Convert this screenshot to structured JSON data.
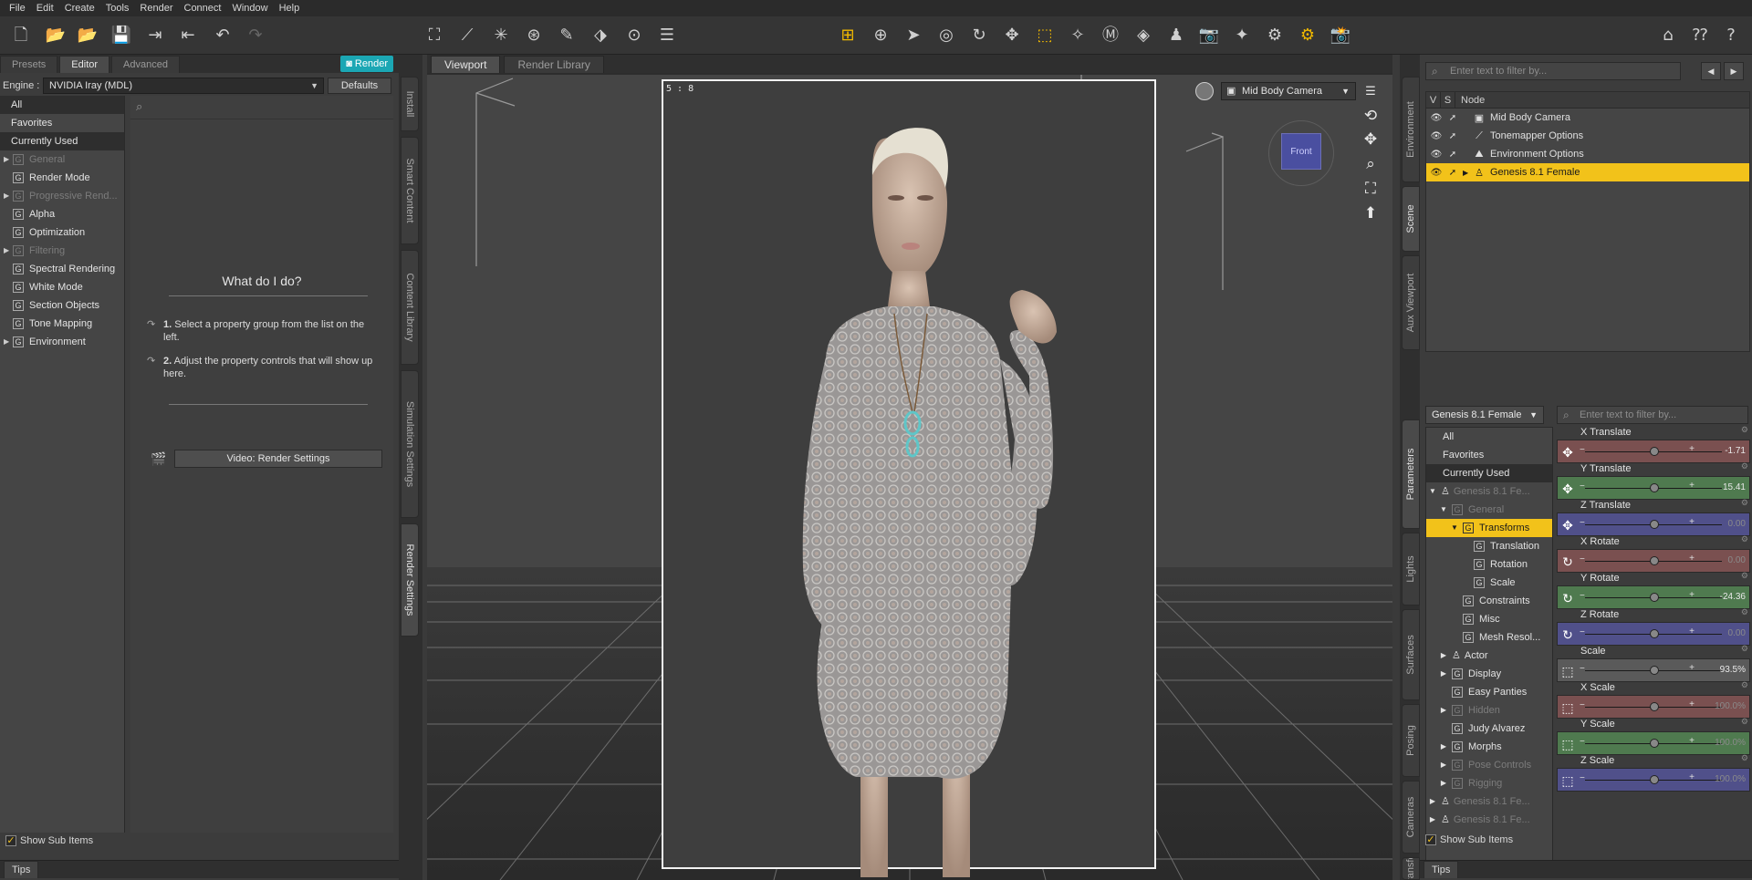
{
  "menu": [
    "File",
    "Edit",
    "Create",
    "Tools",
    "Render",
    "Connect",
    "Window",
    "Help"
  ],
  "left_panel": {
    "tabs": [
      "Presets",
      "Editor",
      "Advanced"
    ],
    "render_button": "Render",
    "engine_label": "Engine :",
    "engine_value": "NVIDIA Iray (MDL)",
    "defaults_button": "Defaults",
    "groups": [
      {
        "label": "All",
        "kind": "plain",
        "selected": true
      },
      {
        "label": "Favorites",
        "kind": "plain"
      },
      {
        "label": "Currently Used",
        "kind": "plain",
        "selected": true
      },
      {
        "label": "General",
        "kind": "group",
        "expandable": true,
        "dim": true
      },
      {
        "label": "Render Mode",
        "kind": "group"
      },
      {
        "label": "Progressive Rend...",
        "kind": "group",
        "expandable": true,
        "dim": true
      },
      {
        "label": "Alpha",
        "kind": "group"
      },
      {
        "label": "Optimization",
        "kind": "group"
      },
      {
        "label": "Filtering",
        "kind": "group",
        "expandable": true,
        "dim": true
      },
      {
        "label": "Spectral Rendering",
        "kind": "group"
      },
      {
        "label": "White Mode",
        "kind": "group"
      },
      {
        "label": "Section Objects",
        "kind": "group"
      },
      {
        "label": "Tone Mapping",
        "kind": "group"
      },
      {
        "label": "Environment",
        "kind": "group",
        "expandable": true
      }
    ],
    "help_title": "What do I do?",
    "step1_num": "1.",
    "step1_text": "Select a property group from the list on the left.",
    "step2_num": "2.",
    "step2_text": "Adjust the property controls that will show up here.",
    "video_button": "Video: Render Settings",
    "show_sub_items": "Show Sub Items",
    "tips_tab": "Tips",
    "side_tabs": [
      "Install",
      "Smart Content",
      "Content Library",
      "Simulation Settings",
      "Render Settings"
    ]
  },
  "viewport": {
    "tabs": [
      "Viewport",
      "Render Library"
    ],
    "aspect_ratio": "5 : 8",
    "camera": "Mid Body Camera",
    "cube_label": "Front"
  },
  "scene_panel": {
    "filter_placeholder": "Enter text to filter by...",
    "col_v": "V",
    "col_s": "S",
    "col_node": "Node",
    "nodes": [
      {
        "label": "Mid Body Camera",
        "icon": "camera-icon"
      },
      {
        "label": "Tonemapper Options",
        "icon": "tonemapper-icon"
      },
      {
        "label": "Environment Options",
        "icon": "environment-icon"
      },
      {
        "label": "Genesis 8.1 Female",
        "icon": "figure-icon",
        "selected": true
      }
    ],
    "side_tabs": [
      "Environment",
      "Scene",
      "Aux Viewport"
    ]
  },
  "parameters_panel": {
    "node_select": "Genesis 8.1 Female",
    "filter_placeholder": "Enter text to filter by...",
    "tree": [
      {
        "label": "All",
        "indent": 0
      },
      {
        "label": "Favorites",
        "indent": 0
      },
      {
        "label": "Currently Used",
        "indent": 0,
        "selected": true
      },
      {
        "label": "Genesis 8.1 Fe...",
        "indent": 0,
        "tri": "▼",
        "dim": true,
        "icon": "figure"
      },
      {
        "label": "General",
        "indent": 1,
        "tri": "▼",
        "dim": true,
        "icon": "G"
      },
      {
        "label": "Transforms",
        "indent": 2,
        "tri": "▼",
        "icon": "G",
        "highlight": true
      },
      {
        "label": "Translation",
        "indent": 3,
        "icon": "G"
      },
      {
        "label": "Rotation",
        "indent": 3,
        "icon": "G"
      },
      {
        "label": "Scale",
        "indent": 3,
        "icon": "G"
      },
      {
        "label": "Constraints",
        "indent": 2,
        "icon": "G"
      },
      {
        "label": "Misc",
        "indent": 2,
        "icon": "G"
      },
      {
        "label": "Mesh Resol...",
        "indent": 2,
        "icon": "G"
      },
      {
        "label": "Actor",
        "indent": 1,
        "tri": "▶",
        "icon": "figure"
      },
      {
        "label": "Display",
        "indent": 1,
        "tri": "▶",
        "icon": "G"
      },
      {
        "label": "Easy Panties",
        "indent": 1,
        "icon": "G"
      },
      {
        "label": "Hidden",
        "indent": 1,
        "tri": "▶",
        "dim": true,
        "icon": "G"
      },
      {
        "label": "Judy Alvarez",
        "indent": 1,
        "icon": "G"
      },
      {
        "label": "Morphs",
        "indent": 1,
        "tri": "▶",
        "icon": "G"
      },
      {
        "label": "Pose Controls",
        "indent": 1,
        "tri": "▶",
        "dim": true,
        "icon": "G"
      },
      {
        "label": "Rigging",
        "indent": 1,
        "tri": "▶",
        "dim": true,
        "icon": "G"
      },
      {
        "label": "Genesis 8.1 Fe...",
        "indent": 0,
        "tri": "▶",
        "dim": true,
        "icon": "figure"
      },
      {
        "label": "Genesis 8.1 Fe...",
        "indent": 0,
        "tri": "▶",
        "dim": true,
        "icon": "figure"
      }
    ],
    "sliders": [
      {
        "name": "X Translate",
        "value": "-1.71",
        "fraction": 0.5,
        "color": "#7a5050",
        "icon": "move-icon",
        "active": true
      },
      {
        "name": "Y Translate",
        "value": "15.41",
        "fraction": 0.5,
        "color": "#4f7a4f",
        "icon": "move-icon",
        "active": true
      },
      {
        "name": "Z Translate",
        "value": "0.00",
        "fraction": 0.5,
        "color": "#50508a",
        "icon": "move-icon",
        "active": false
      },
      {
        "name": "X Rotate",
        "value": "0.00",
        "fraction": 0.5,
        "color": "#7a5050",
        "icon": "rotate-icon",
        "active": false
      },
      {
        "name": "Y Rotate",
        "value": "-24.36",
        "fraction": 0.5,
        "color": "#4f7a4f",
        "icon": "rotate-icon",
        "active": true
      },
      {
        "name": "Z Rotate",
        "value": "0.00",
        "fraction": 0.5,
        "color": "#50508a",
        "icon": "rotate-icon",
        "active": false
      },
      {
        "name": "Scale",
        "value": "93.5%",
        "fraction": 0.5,
        "color": "#5a5a5a",
        "icon": "scale-icon",
        "active": true
      },
      {
        "name": "X Scale",
        "value": "100.0%",
        "fraction": 0.5,
        "color": "#7a5050",
        "icon": "scale-icon",
        "active": false
      },
      {
        "name": "Y Scale",
        "value": "100.0%",
        "fraction": 0.5,
        "color": "#4f7a4f",
        "icon": "scale-icon",
        "active": false
      },
      {
        "name": "Z Scale",
        "value": "100.0%",
        "fraction": 0.5,
        "color": "#50508a",
        "icon": "scale-icon",
        "active": false
      }
    ],
    "show_sub_items": "Show Sub Items",
    "tips_tab": "Tips",
    "side_tabs": [
      "Parameters",
      "Lights",
      "Surfaces",
      "Posing",
      "Cameras",
      "Transfer"
    ]
  },
  "colors": {
    "selection_yellow": "#f2c21a",
    "render_button": "#1ba7b4"
  }
}
